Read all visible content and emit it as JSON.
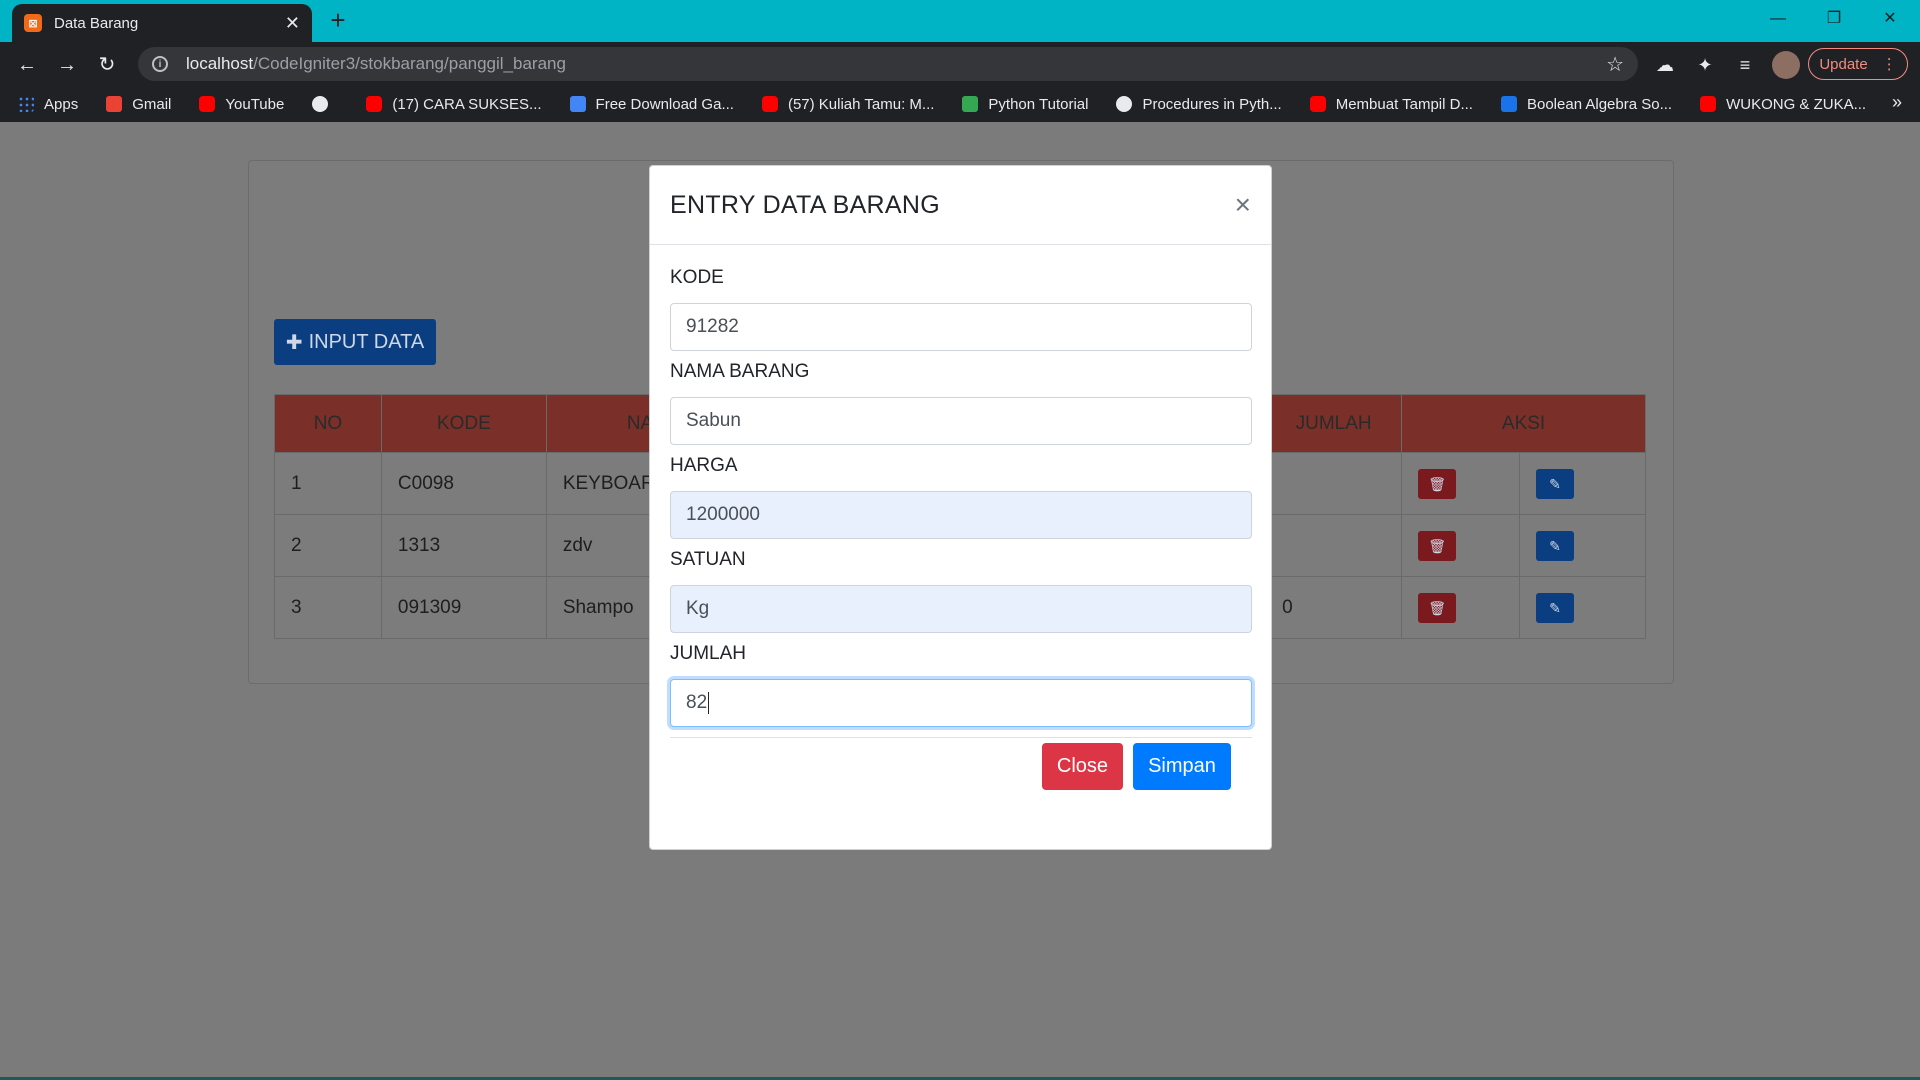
{
  "browser": {
    "tab_title": "Data Barang",
    "url_host": "localhost",
    "url_path": "/CodeIgniter3/stokbarang/panggil_barang",
    "update_label": "Update",
    "bookmarks": [
      {
        "icon": "apps-icon",
        "label": "Apps"
      },
      {
        "icon": "gmail-icon",
        "label": "Gmail"
      },
      {
        "icon": "youtube-icon",
        "label": "YouTube"
      },
      {
        "icon": "globe-icon",
        "label": ""
      },
      {
        "icon": "youtube-icon",
        "label": "(17) CARA SUKSES..."
      },
      {
        "icon": "h-icon",
        "label": "Free Download Ga..."
      },
      {
        "icon": "youtube-icon",
        "label": "(57) Kuliah Tamu: M..."
      },
      {
        "icon": "w-icon",
        "label": "Python Tutorial"
      },
      {
        "icon": "globe-icon",
        "label": "Procedures in Pyth..."
      },
      {
        "icon": "youtube-icon",
        "label": "Membuat Tampil D..."
      },
      {
        "icon": "b-icon",
        "label": "Boolean Algebra So..."
      },
      {
        "icon": "youtube-icon",
        "label": "WUKONG & ZUKA..."
      }
    ],
    "more_label": "»"
  },
  "page": {
    "input_data_label": "INPUT DATA",
    "columns": [
      "NO",
      "KODE",
      "NA",
      "JUMLAH",
      "AKSI"
    ],
    "rows": [
      {
        "no": "1",
        "kode": "C0098",
        "nama": "KEYBOAR",
        "jumlah": ""
      },
      {
        "no": "2",
        "kode": "1313",
        "nama": "zdv",
        "jumlah": ""
      },
      {
        "no": "3",
        "kode": "091309",
        "nama": "Shampo",
        "jumlah": "0"
      }
    ]
  },
  "modal": {
    "title": "ENTRY DATA BARANG",
    "close_symbol": "×",
    "fields": {
      "kode": {
        "label": "KODE",
        "value": "91282"
      },
      "nama": {
        "label": "NAMA BARANG",
        "value": "Sabun"
      },
      "harga": {
        "label": "HARGA",
        "value": "1200000"
      },
      "satuan": {
        "label": "SATUAN",
        "value": "Kg"
      },
      "jumlah": {
        "label": "JUMLAH",
        "value": "82"
      }
    },
    "close_label": "Close",
    "save_label": "Simpan"
  },
  "colors": {
    "tabstrip": "#00b4c6",
    "chrome_dark": "#202124",
    "table_header": "#c0392b",
    "btn_danger": "#dc3545",
    "btn_primary": "#007bff",
    "autofill": "#e8f0fe"
  }
}
